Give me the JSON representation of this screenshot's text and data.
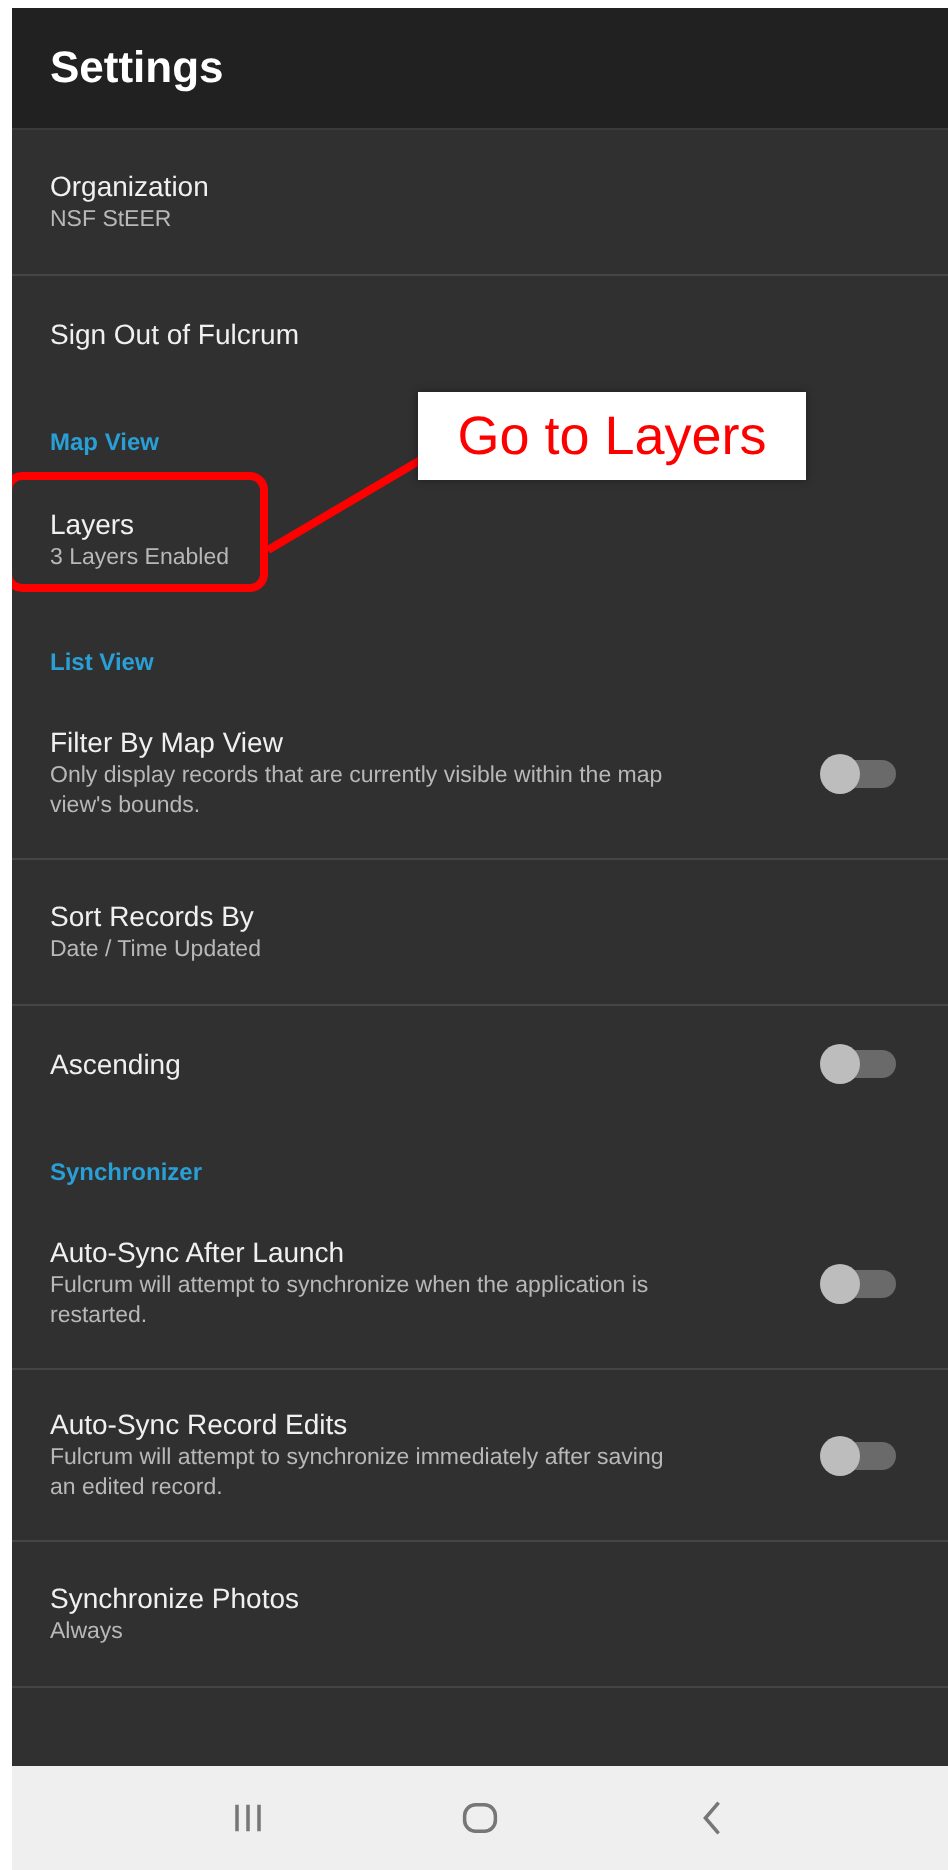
{
  "app_bar": {
    "title": "Settings"
  },
  "items": [
    {
      "kind": "item",
      "title": "Organization",
      "subtitle": "NSF StEER",
      "divider": true
    },
    {
      "kind": "item",
      "title": "Sign Out of Fulcrum",
      "divider": false
    },
    {
      "kind": "section",
      "title": "Map View"
    },
    {
      "kind": "item",
      "title": "Layers",
      "subtitle": "3 Layers Enabled",
      "divider": false,
      "highlighted": true
    },
    {
      "kind": "section",
      "title": "List View"
    },
    {
      "kind": "toggle",
      "title": "Filter By Map View",
      "subtitle": "Only display records that are currently visible within the map view's bounds.",
      "on": false,
      "divider": true
    },
    {
      "kind": "item",
      "title": "Sort Records By",
      "subtitle": "Date / Time Updated",
      "divider": true
    },
    {
      "kind": "toggle",
      "title": "Ascending",
      "on": false,
      "divider": false
    },
    {
      "kind": "section",
      "title": "Synchronizer"
    },
    {
      "kind": "toggle",
      "title": "Auto-Sync After Launch",
      "subtitle": "Fulcrum will attempt to synchronize when the application is restarted.",
      "on": false,
      "divider": true
    },
    {
      "kind": "toggle",
      "title": "Auto-Sync Record Edits",
      "subtitle": "Fulcrum will attempt to synchronize immediately after saving an edited record.",
      "on": false,
      "divider": true
    },
    {
      "kind": "item",
      "title": "Synchronize Photos",
      "subtitle": "Always",
      "divider": true
    }
  ],
  "callout": {
    "text": "Go to Layers"
  }
}
